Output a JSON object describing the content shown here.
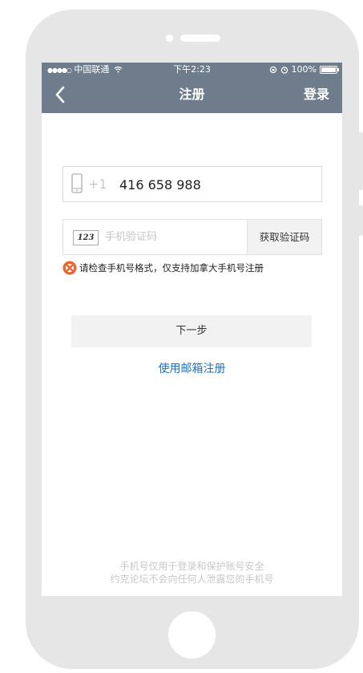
{
  "status_bar": {
    "carrier": "中国联通",
    "time": "下午2:23",
    "battery": "100%",
    "signal_icon": "signal-dots-icon",
    "wifi_icon": "wifi-icon",
    "lock_icon": "orientation-lock-icon",
    "alarm_icon": "alarm-icon"
  },
  "navbar": {
    "title": "注册",
    "right_action": "登录",
    "back_icon": "chevron-left-icon"
  },
  "phone_field": {
    "icon": "mobile-phone-icon",
    "country_code": "+1",
    "value": "416 658 988"
  },
  "code_field": {
    "icon_label": "123",
    "placeholder": "手机验证码",
    "value": "",
    "button_label": "获取验证码"
  },
  "error": {
    "icon": "error-x-icon",
    "message": "请检查手机号格式，仅支持加拿大手机号注册"
  },
  "next_button": {
    "label": "下一步"
  },
  "email_link": {
    "label": "使用邮箱注册"
  },
  "footer": {
    "line1": "手机号仅用于登录和保护账号安全",
    "line2": "约克论坛不会向任何人泄露您的手机号"
  },
  "colors": {
    "navbar": "#6e7c8b",
    "link": "#1a73c8",
    "error_icon": "#f0642d"
  }
}
